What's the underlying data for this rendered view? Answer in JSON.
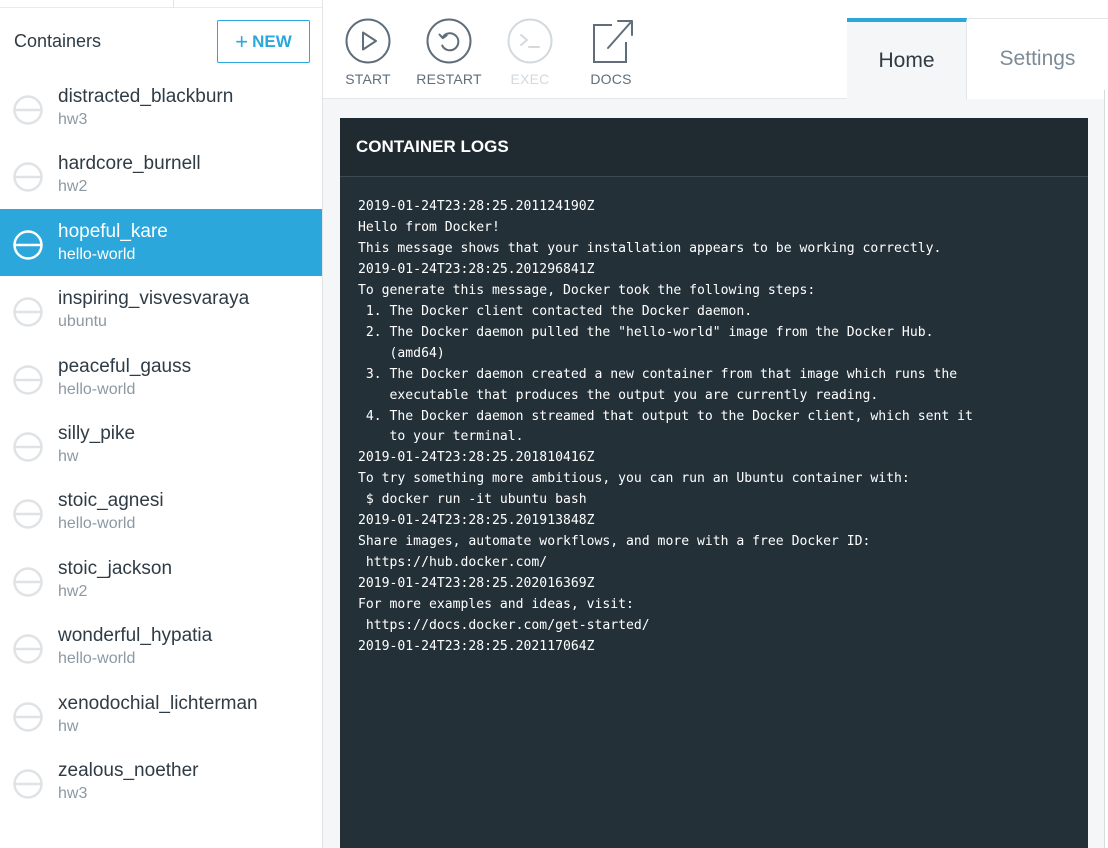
{
  "sidebar": {
    "title": "Containers",
    "new_button": {
      "plus": "+",
      "label": "NEW"
    },
    "containers": [
      {
        "name": "distracted_blackburn",
        "image": "hw3",
        "selected": false
      },
      {
        "name": "hardcore_burnell",
        "image": "hw2",
        "selected": false
      },
      {
        "name": "hopeful_kare",
        "image": "hello-world",
        "selected": true
      },
      {
        "name": "inspiring_visvesvaraya",
        "image": "ubuntu",
        "selected": false
      },
      {
        "name": "peaceful_gauss",
        "image": "hello-world",
        "selected": false
      },
      {
        "name": "silly_pike",
        "image": "hw",
        "selected": false
      },
      {
        "name": "stoic_agnesi",
        "image": "hello-world",
        "selected": false
      },
      {
        "name": "stoic_jackson",
        "image": "hw2",
        "selected": false
      },
      {
        "name": "wonderful_hypatia",
        "image": "hello-world",
        "selected": false
      },
      {
        "name": "xenodochial_lichterman",
        "image": "hw",
        "selected": false
      },
      {
        "name": "zealous_noether",
        "image": "hw3",
        "selected": false
      }
    ],
    "state_icon": "stopped-circle-icon"
  },
  "toolbar": {
    "start": {
      "label": "START",
      "icon": "play-icon"
    },
    "restart": {
      "label": "RESTART",
      "icon": "restart-icon"
    },
    "exec": {
      "label": "EXEC",
      "icon": "terminal-icon",
      "disabled": true
    },
    "docs": {
      "label": "DOCS",
      "icon": "external-link-icon"
    }
  },
  "tabs": {
    "home": "Home",
    "settings": "Settings",
    "active": "home"
  },
  "logs": {
    "title": "CONTAINER LOGS",
    "lines": [
      "2019-01-24T23:28:25.201124190Z",
      "Hello from Docker!",
      "This message shows that your installation appears to be working correctly.",
      "2019-01-24T23:28:25.201296841Z",
      "To generate this message, Docker took the following steps:",
      " 1. The Docker client contacted the Docker daemon.",
      " 2. The Docker daemon pulled the \"hello-world\" image from the Docker Hub.",
      "    (amd64)",
      " 3. The Docker daemon created a new container from that image which runs the",
      "    executable that produces the output you are currently reading.",
      " 4. The Docker daemon streamed that output to the Docker client, which sent it",
      "    to your terminal.",
      "2019-01-24T23:28:25.201810416Z",
      "To try something more ambitious, you can run an Ubuntu container with:",
      " $ docker run -it ubuntu bash",
      "2019-01-24T23:28:25.201913848Z",
      "Share images, automate workflows, and more with a free Docker ID:",
      " https://hub.docker.com/",
      "2019-01-24T23:28:25.202016369Z",
      "For more examples and ideas, visit:",
      " https://docs.docker.com/get-started/",
      "2019-01-24T23:28:25.202117064Z"
    ]
  },
  "colors": {
    "accent": "#2ba7dc",
    "log_background": "#243038",
    "text": "#2f3b45",
    "muted": "#8c99a3"
  }
}
